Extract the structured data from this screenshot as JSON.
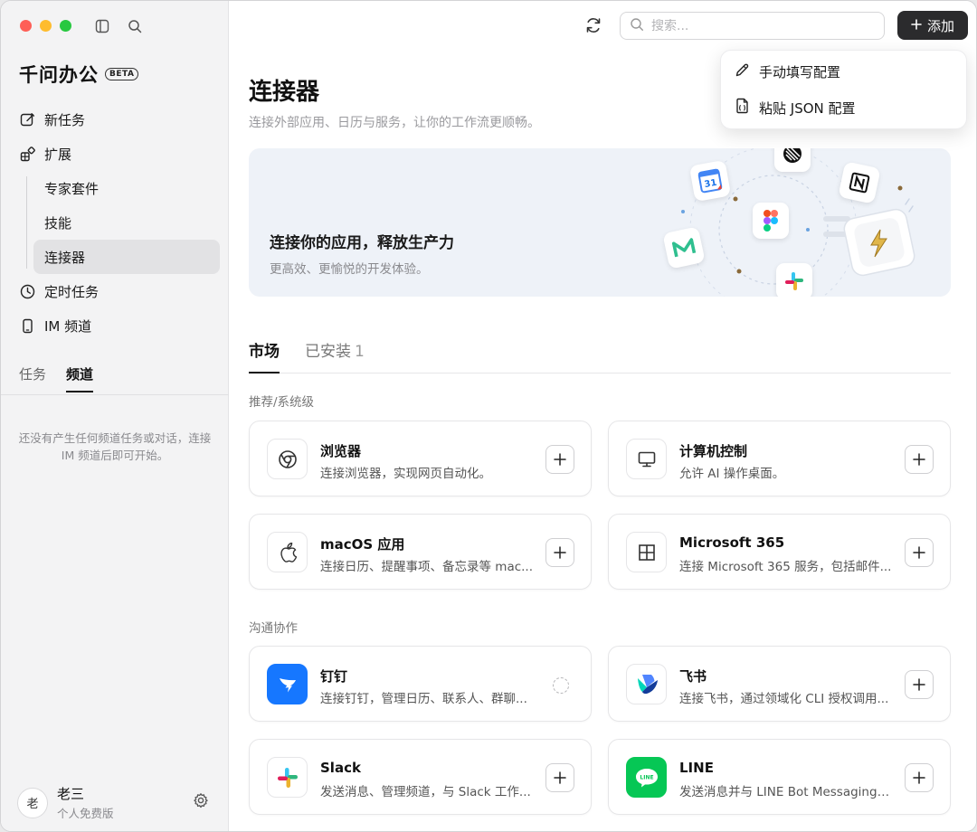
{
  "app": {
    "name": "千问办公",
    "badge": "BETA"
  },
  "sidebar": {
    "nav": [
      {
        "label": "新任务",
        "icon": "edit-icon"
      },
      {
        "label": "扩展",
        "icon": "extensions-icon"
      },
      {
        "label": "专家套件"
      },
      {
        "label": "技能"
      },
      {
        "label": "连接器"
      },
      {
        "label": "定时任务",
        "icon": "clock-icon"
      },
      {
        "label": "IM 频道",
        "icon": "phone-icon"
      }
    ],
    "tabs": [
      "任务",
      "频道"
    ],
    "empty_message": "还没有产生任何频道任务或对话，连接 IM 频道后即可开始。",
    "user": {
      "avatar": "老",
      "name": "老三",
      "plan": "个人免费版"
    }
  },
  "header": {
    "search_placeholder": "搜索...",
    "add_label": "添加"
  },
  "dropdown": {
    "items": [
      {
        "label": "手动填写配置",
        "icon": "pen-icon"
      },
      {
        "label": "粘贴 JSON 配置",
        "icon": "paste-file-icon"
      }
    ]
  },
  "page": {
    "title": "连接器",
    "subtitle": "连接外部应用、日历与服务，让你的工作流更顺畅。"
  },
  "banner": {
    "title": "连接你的应用，释放生产力",
    "subtitle": "更高效、更愉悦的开发体验。"
  },
  "tabs": {
    "market": "市场",
    "installed": "已安装",
    "installed_count": "1"
  },
  "sections": [
    {
      "title": "推荐/系统级",
      "cards": [
        {
          "name": "浏览器",
          "desc": "连接浏览器，实现网页自动化。",
          "icon": "chrome-icon"
        },
        {
          "name": "计算机控制",
          "desc": "允许 AI 操作桌面。",
          "icon": "monitor-icon"
        },
        {
          "name": "macOS 应用",
          "desc": "连接日历、提醒事项、备忘录等 mac...",
          "icon": "apple-icon"
        },
        {
          "name": "Microsoft 365",
          "desc": "连接 Microsoft 365 服务，包括邮件...",
          "icon": "windows-grid-icon"
        }
      ]
    },
    {
      "title": "沟通协作",
      "cards": [
        {
          "name": "钉钉",
          "desc": "连接钉钉，管理日历、联系人、群聊...",
          "icon": "dingtalk-icon"
        },
        {
          "name": "飞书",
          "desc": "连接飞书，通过领域化 CLI 授权调用...",
          "icon": "feishu-icon"
        },
        {
          "name": "Slack",
          "desc": "发送消息、管理频道，与 Slack 工作...",
          "icon": "slack-icon"
        },
        {
          "name": "LINE",
          "desc": "发送消息并与 LINE Bot Messaging ...",
          "icon": "line-icon"
        }
      ]
    }
  ],
  "colors": {
    "accent_dark": "#2b2b2d",
    "dingtalk": "#1677ff",
    "line": "#06c755"
  }
}
